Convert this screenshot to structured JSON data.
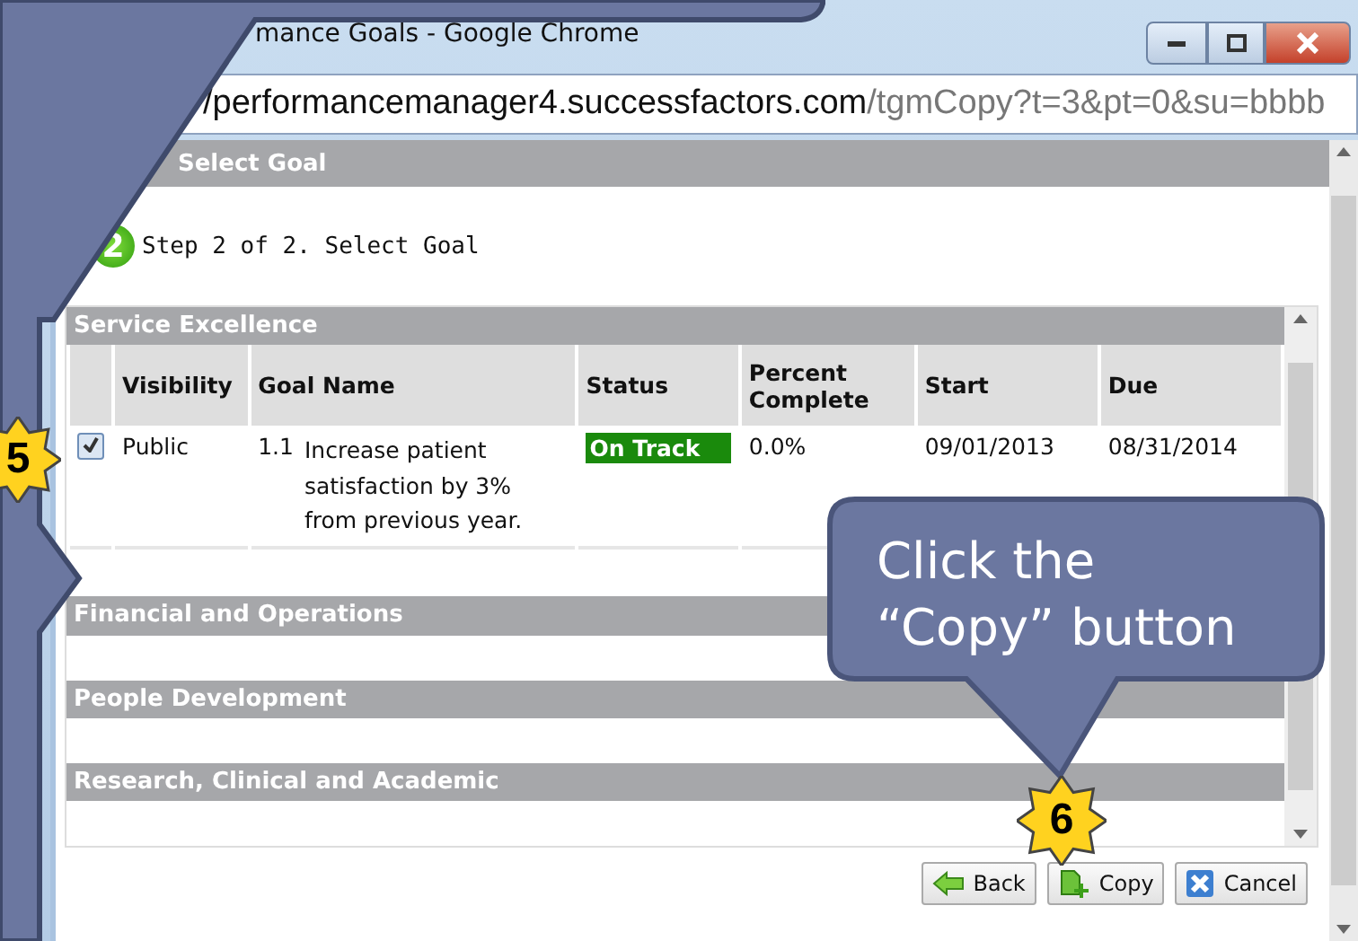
{
  "window": {
    "title": "mance Goals - Google Chrome"
  },
  "address_bar": {
    "host": "/performancemanager4.successfactors.com",
    "path": "/tgmCopy?t=3&pt=0&su=bbbb"
  },
  "dialog": {
    "title": "Select Goal",
    "step": {
      "number": "2",
      "text": "Step 2 of 2. Select Goal"
    }
  },
  "sections": [
    {
      "title": "Service Excellence",
      "columns": [
        "Visibility",
        "Goal Name",
        "Status",
        "Percent Complete",
        "Start",
        "Due"
      ],
      "rows": [
        {
          "checked": true,
          "visibility": "Public",
          "number": "1.1",
          "goal_name": "Increase patient satisfaction by 3% from previous year.",
          "status": "On Track",
          "percent_complete": "0.0%",
          "start": "09/01/2013",
          "due": "08/31/2014"
        }
      ]
    },
    {
      "title": "Financial and Operations"
    },
    {
      "title": "People Development"
    },
    {
      "title": "Research, Clinical and Academic"
    }
  ],
  "buttons": [
    {
      "label": "Back",
      "kind": "back"
    },
    {
      "label": "Copy",
      "kind": "copy"
    },
    {
      "label": "Cancel",
      "kind": "cancel"
    }
  ],
  "callout": {
    "lines": [
      "Click the",
      "“Copy” button"
    ]
  },
  "step_badges": [
    "5",
    "6"
  ]
}
